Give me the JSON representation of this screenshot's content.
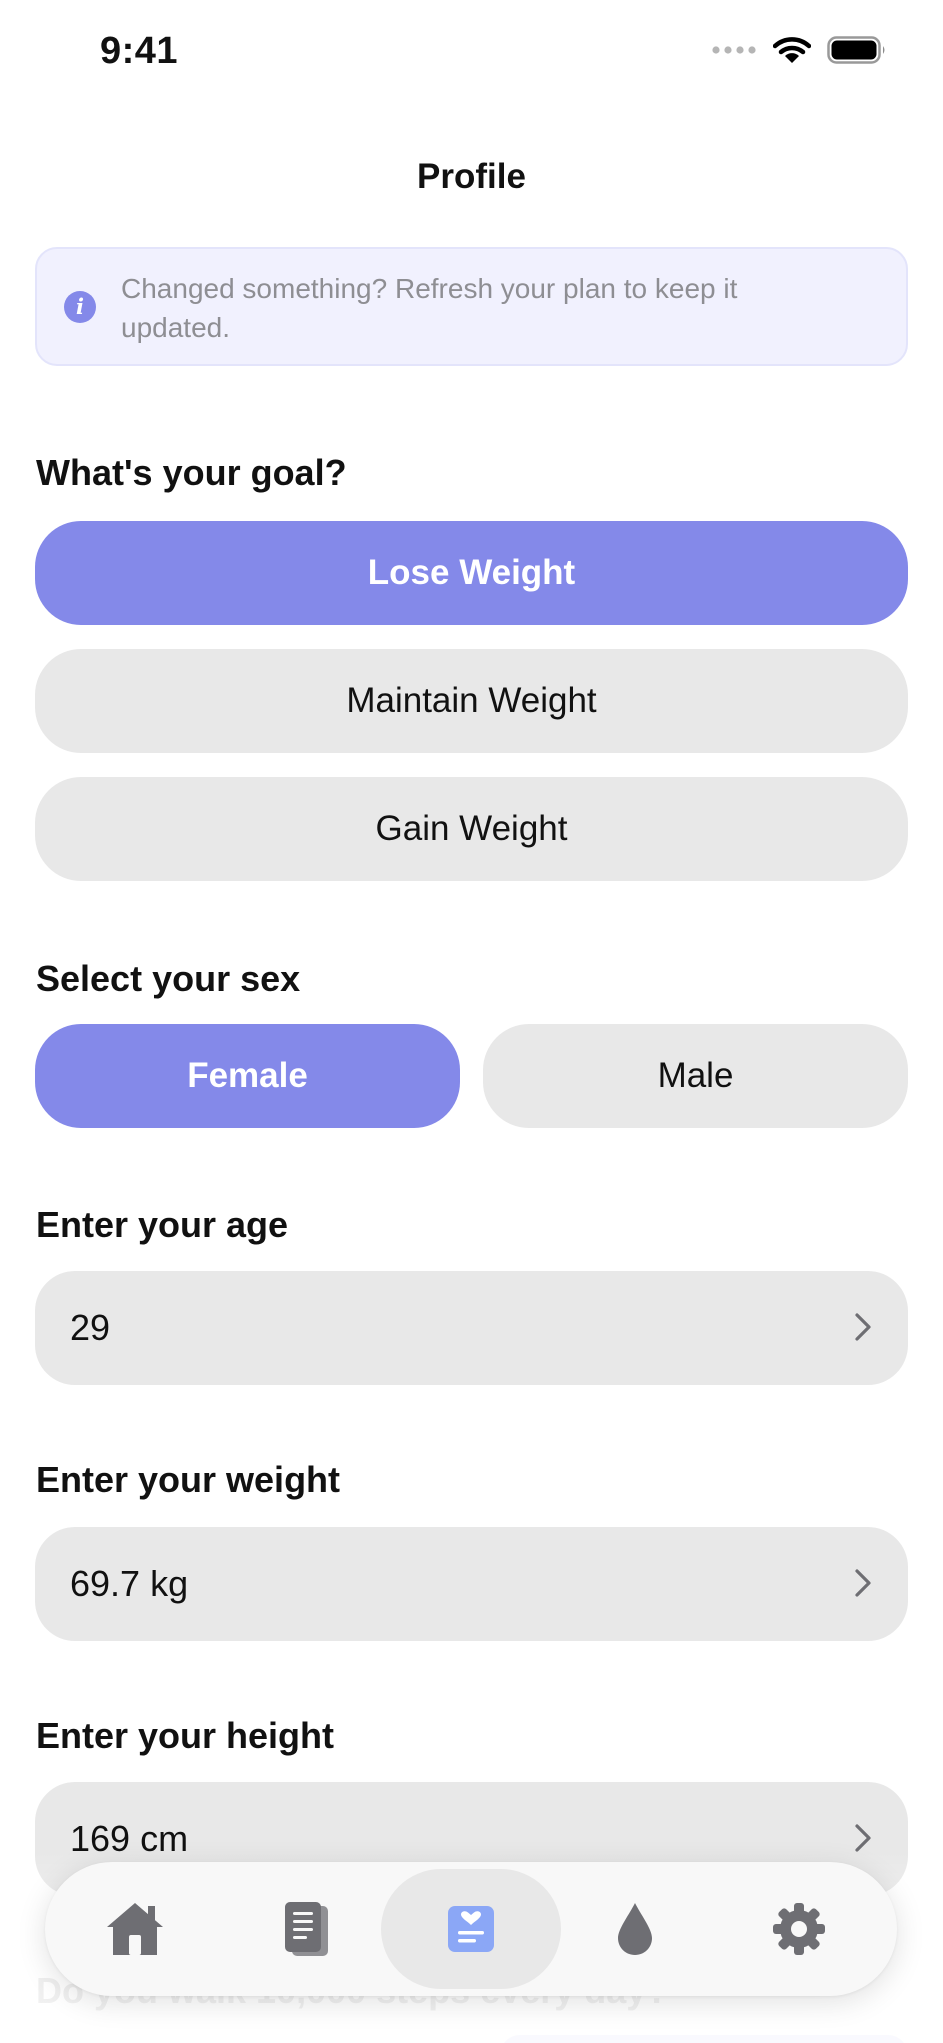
{
  "status_bar": {
    "time": "9:41"
  },
  "header": {
    "title": "Profile"
  },
  "banner": {
    "message": "Changed something? Refresh your plan to keep it updated.",
    "icon": "info-icon"
  },
  "goal": {
    "label": "What's your goal?",
    "options": [
      "Lose Weight",
      "Maintain Weight",
      "Gain Weight"
    ],
    "selected": "Lose Weight"
  },
  "sex": {
    "label": "Select your sex",
    "options": [
      "Female",
      "Male"
    ],
    "selected": "Female"
  },
  "age": {
    "label": "Enter your age",
    "value": "29"
  },
  "weight": {
    "label": "Enter your weight",
    "value": "69.7 kg"
  },
  "height": {
    "label": "Enter your height",
    "value": "169 cm"
  },
  "steps": {
    "label": "Do you walk 10,000 steps every day?"
  },
  "tab_bar": {
    "tabs": [
      "home-icon",
      "journal-icon",
      "health-profile-icon",
      "water-drop-icon",
      "settings-gear-icon"
    ],
    "active_index": 2
  },
  "colors": {
    "accent": "#8489e9",
    "pill_bg": "#e8e8e8",
    "banner_bg": "#f1f1fe",
    "icon_gray": "#6e6e73"
  }
}
